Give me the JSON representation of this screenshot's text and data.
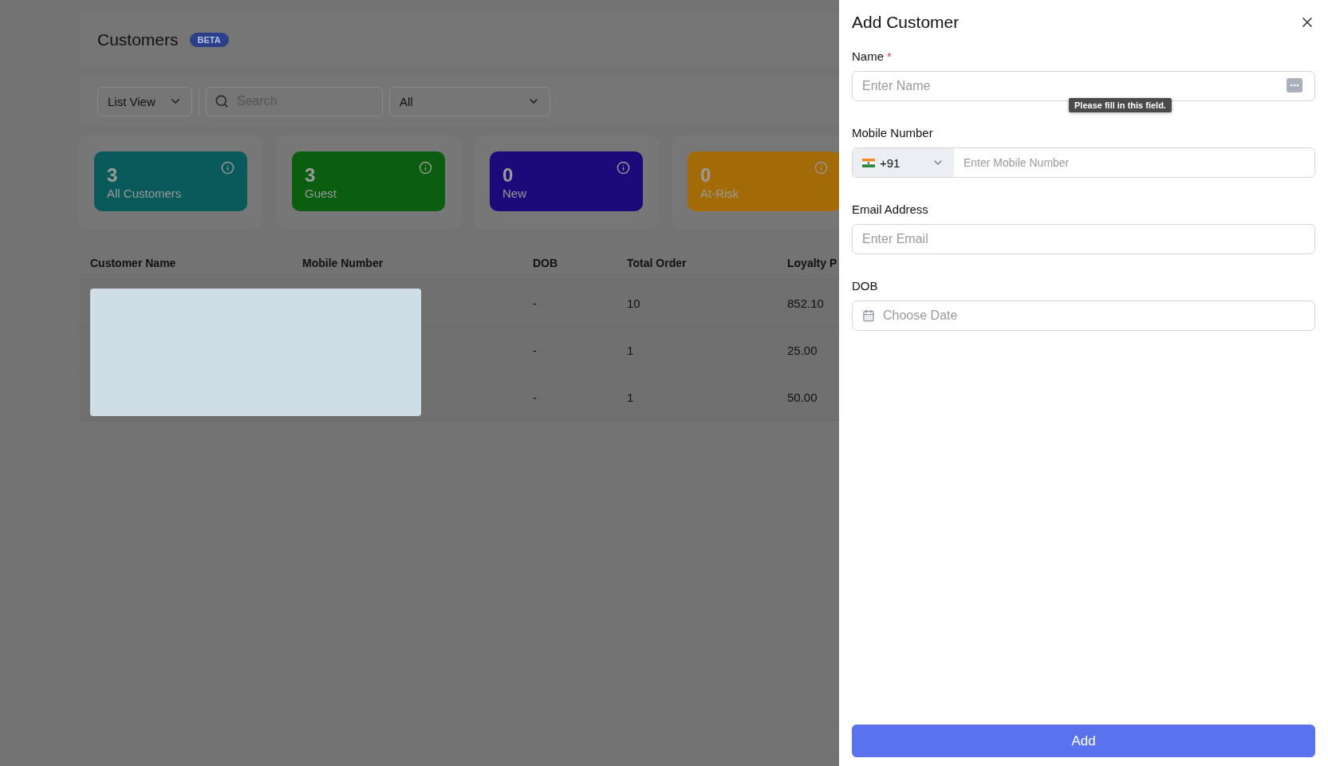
{
  "page": {
    "title": "Customers",
    "badge": "BETA"
  },
  "toolbar": {
    "view_select": "List View",
    "search": {
      "placeholder": "Search"
    },
    "filter_select": "All"
  },
  "stats": [
    {
      "value": "3",
      "label": "All Customers",
      "color": "#0a5a5c"
    },
    {
      "value": "3",
      "label": "Guest",
      "color": "#0b5d10"
    },
    {
      "value": "0",
      "label": "New",
      "color": "#1d0a7a"
    },
    {
      "value": "0",
      "label": "At-Risk",
      "color": "#a36a08"
    }
  ],
  "table": {
    "columns": [
      "Customer Name",
      "Mobile Number",
      "DOB",
      "Total Order",
      "Loyalty P"
    ],
    "rows": [
      {
        "dob": "-",
        "total_order": "10",
        "loyalty": "852.10"
      },
      {
        "dob": "-",
        "total_order": "1",
        "loyalty": "25.00"
      },
      {
        "dob": "-",
        "total_order": "1",
        "loyalty": "50.00"
      }
    ]
  },
  "drawer": {
    "title": "Add Customer",
    "name": {
      "label": "Name",
      "required_mark": "*",
      "placeholder": "Enter Name",
      "tooltip": "Please fill in this field."
    },
    "mobile": {
      "label": "Mobile Number",
      "country_code": "+91",
      "placeholder": "Enter Mobile Number"
    },
    "email": {
      "label": "Email Address",
      "placeholder": "Enter Email"
    },
    "dob": {
      "label": "DOB",
      "placeholder": "Choose Date"
    },
    "submit": "Add"
  }
}
